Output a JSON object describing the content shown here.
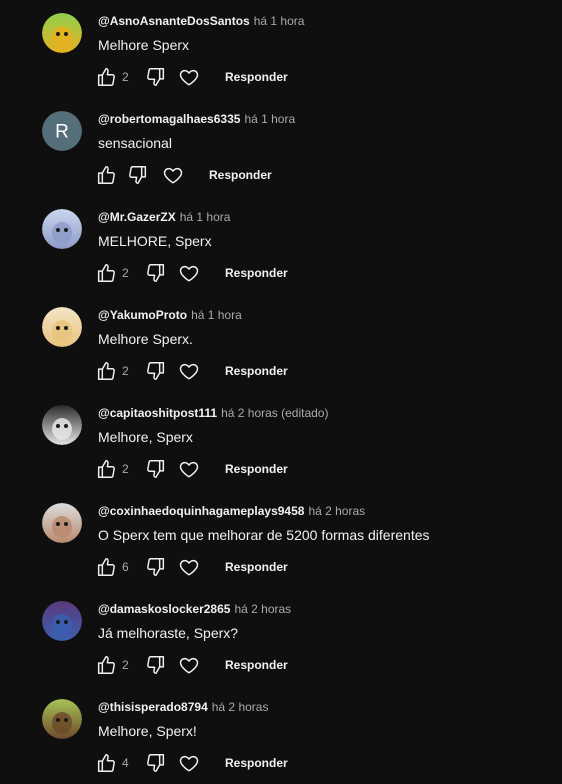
{
  "comments": [
    {
      "author": "@AsnoAsnanteDosSantos",
      "time": "há 1 hora",
      "text": "Melhore Sperx",
      "likes": "2",
      "reply": "Responder",
      "avatar_colors": [
        "#8fd14f",
        "#e8b020"
      ],
      "avatar_icon": "cartoon-face-icon"
    },
    {
      "author": "@robertomagalhaes6335",
      "time": "há 1 hora",
      "text": "sensacional",
      "likes": "",
      "reply": "Responder",
      "avatar_letter": "R",
      "avatar_colors": [
        "#546e7a",
        "#546e7a"
      ]
    },
    {
      "author": "@Mr.GazerZX",
      "time": "há 1 hora",
      "text": "MELHORE, Sperx",
      "likes": "2",
      "reply": "Responder",
      "avatar_colors": [
        "#c9d6ee",
        "#8e9bc8"
      ],
      "avatar_icon": "anime-character-icon"
    },
    {
      "author": "@YakumoProto",
      "time": "há 1 hora",
      "text": "Melhore Sperx.",
      "likes": "2",
      "reply": "Responder",
      "avatar_colors": [
        "#f3e6c8",
        "#e8c37c"
      ],
      "avatar_icon": "anime-character-icon"
    },
    {
      "author": "@capitaoshitpost111",
      "time": "há 2 horas (editado)",
      "text": "Melhore, Sperx",
      "likes": "2",
      "reply": "Responder",
      "avatar_colors": [
        "#2b2b2b",
        "#e5e5e5"
      ],
      "avatar_icon": "penguin-icon"
    },
    {
      "author": "@coxinhaedoquinhagameplays9458",
      "time": "há 2 horas",
      "text": "O Sperx tem que melhorar de 5200 formas diferentes",
      "likes": "6",
      "reply": "Responder",
      "avatar_colors": [
        "#dcdcdc",
        "#b98a6e"
      ],
      "avatar_icon": "person-photo-icon"
    },
    {
      "author": "@damaskoslocker2865",
      "time": "há 2 horas",
      "text": "Já melhoraste, Sperx?",
      "likes": "2",
      "reply": "Responder",
      "avatar_colors": [
        "#5b3a7a",
        "#3b5fb0"
      ],
      "avatar_icon": "anime-character-icon"
    },
    {
      "author": "@thisisperado8794",
      "time": "há 2 horas",
      "text": "Melhore, Sperx!",
      "likes": "4",
      "reply": "Responder",
      "avatar_colors": [
        "#a7c25a",
        "#6e4a2a"
      ],
      "avatar_icon": "owl-icon"
    }
  ]
}
